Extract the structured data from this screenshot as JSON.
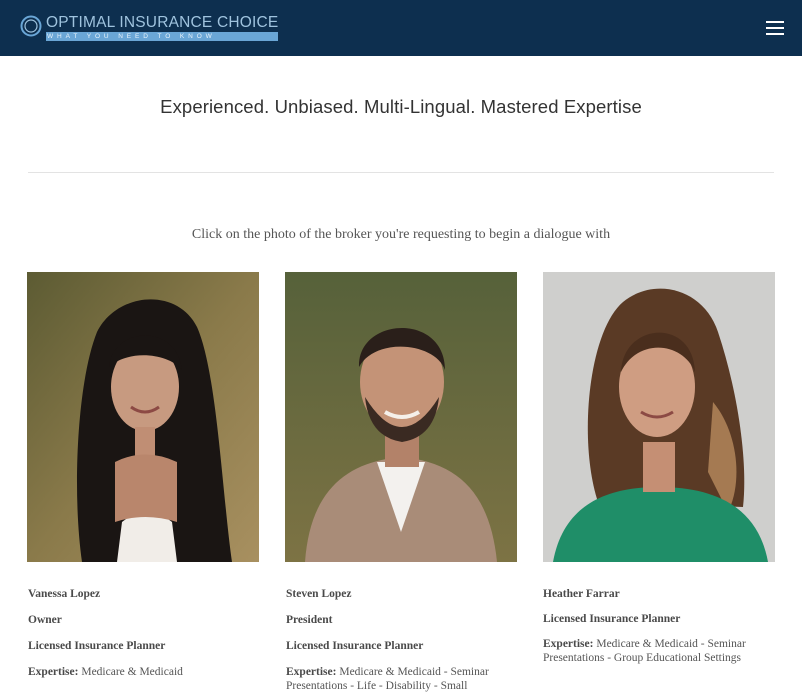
{
  "header": {
    "logo_title": "OPTIMAL INSURANCE CHOICE",
    "logo_tagline": "WHAT YOU NEED TO KNOW",
    "brand_color": "#0d2f4f",
    "menu_icon": "hamburger-menu-icon"
  },
  "headline": "Experienced. Unbiased. Multi-Lingual. Mastered Expertise",
  "instruction": "Click on the photo of the broker you're requesting to begin a dialogue with",
  "brokers": [
    {
      "name": "Vanessa Lopez",
      "role": "Owner",
      "title": "Licensed Insurance Planner",
      "expertise_label": "Expertise:",
      "expertise": "Medicare & Medicaid"
    },
    {
      "name": "Steven Lopez",
      "role": "President",
      "title": "Licensed Insurance Planner",
      "expertise_label": "Expertise:",
      "expertise": "Medicare & Medicaid - Seminar Presentations - Life - Disability - Small"
    },
    {
      "name": "Heather Farrar",
      "title": "Licensed Insurance Planner",
      "expertise_label": "Expertise:",
      "expertise": "Medicare & Medicaid - Seminar Presentations - Group Educational Settings"
    }
  ]
}
